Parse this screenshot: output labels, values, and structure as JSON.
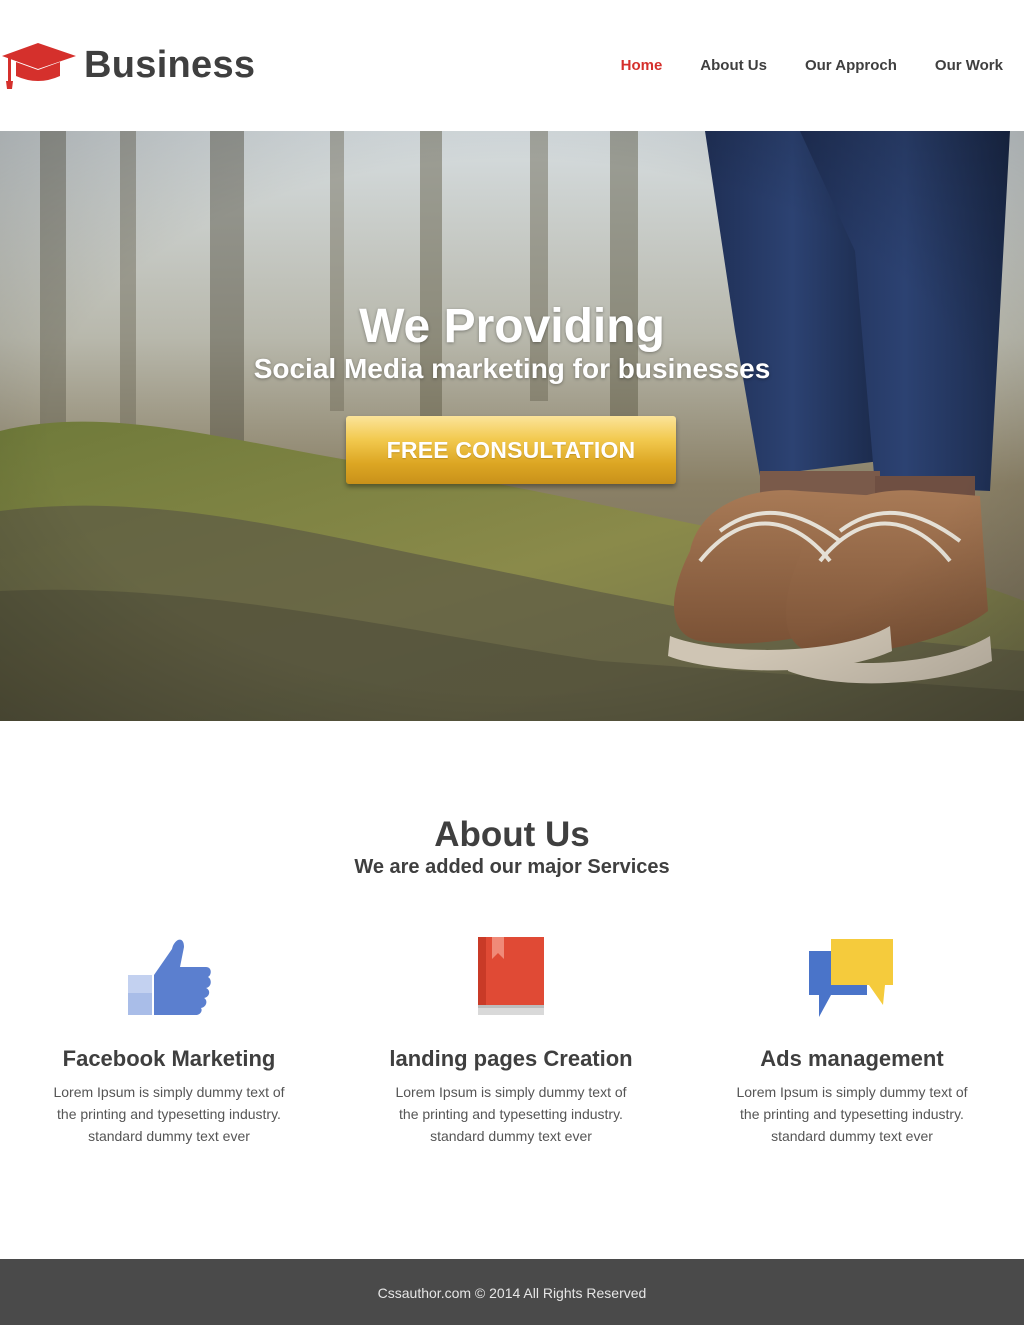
{
  "header": {
    "logo_text": "Business",
    "logo_icon": "graduation-cap-icon",
    "nav": [
      {
        "label": "Home",
        "active": true
      },
      {
        "label": "About Us",
        "active": false
      },
      {
        "label": "Our Approch",
        "active": false
      },
      {
        "label": "Our Work",
        "active": false
      }
    ]
  },
  "hero": {
    "title": "We Providing",
    "subtitle": "Social Media marketing for businesses",
    "cta_label": "FREE CONSULTATION"
  },
  "about": {
    "title": "About Us",
    "subtitle": "We are added our major Services",
    "services": [
      {
        "icon": "thumbs-up-icon",
        "title": "Facebook Marketing",
        "text": "Lorem Ipsum is simply dummy text of the printing and typesetting industry. standard dummy text ever"
      },
      {
        "icon": "book-icon",
        "title": "landing pages Creation",
        "text": "Lorem Ipsum is simply dummy text of the printing and typesetting industry. standard dummy text ever"
      },
      {
        "icon": "chat-bubbles-icon",
        "title": "Ads management",
        "text": "Lorem Ipsum is simply dummy text of the printing and typesetting industry. standard dummy text ever"
      }
    ]
  },
  "footer": {
    "text": "Cssauthor.com © 2014 All Rights Reserved"
  },
  "colors": {
    "accent": "#d5302c",
    "text": "#3f3f3f",
    "cta_gold": "#e0ad2a",
    "footer_bg": "#4a4a4a",
    "facebook_blue": "#5b7fcf",
    "book_red": "#e04a35",
    "chat_blue": "#4a74c9",
    "chat_yellow": "#f5cb3c"
  }
}
